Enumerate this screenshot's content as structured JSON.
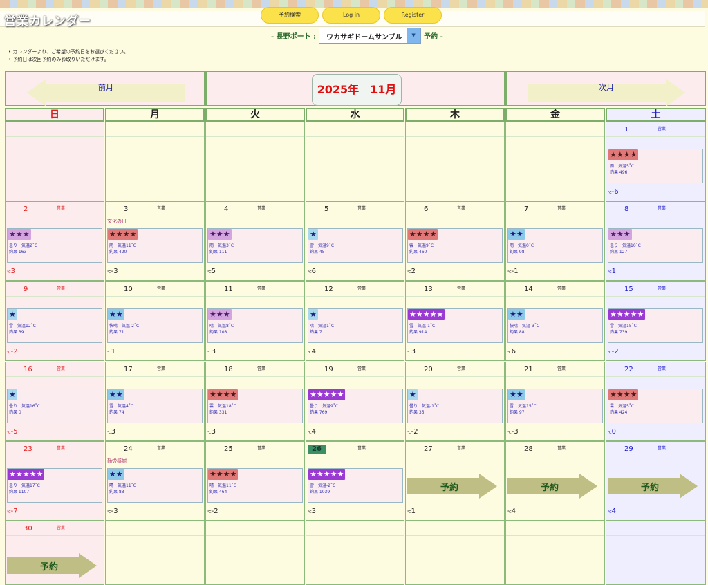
{
  "header": {
    "app_title": "営業カレンダー",
    "buttons": [
      "予約検索",
      "Log in",
      "Register"
    ]
  },
  "port": {
    "prefix": "- 長野ポート :",
    "selected": "ワカサギドームサンプル",
    "suffix": "予約 -"
  },
  "notes": [
    "カレンダーより、ご希望の予約日をお選びください。",
    "予約日は次回予約のみお取りいただけます。"
  ],
  "calendar": {
    "prev": "前月",
    "next": "次月",
    "month_label": "2025年　11月",
    "weekdays": [
      "日",
      "月",
      "火",
      "水",
      "木",
      "金",
      "土"
    ],
    "open_label": "営業",
    "reserve_label": "予約",
    "days": [
      {
        "d": "1",
        "col": 6,
        "row": 0,
        "stars": "★★★★",
        "level": 4,
        "weather": "雨　気温5˚C",
        "catch": "釣果 496",
        "water": "-6",
        "open": true
      },
      {
        "d": "2",
        "col": 0,
        "row": 1,
        "stars": "★★★",
        "level": 3,
        "weather": "曇り　気温2˚C",
        "catch": "釣果 163",
        "water": "3",
        "open": true
      },
      {
        "d": "3",
        "col": 1,
        "row": 1,
        "stars": "★★★★",
        "level": 4,
        "weather": "雨　気温11˚C",
        "catch": "釣果 420",
        "water": "-3",
        "open": true,
        "holiday": "文化の日"
      },
      {
        "d": "4",
        "col": 2,
        "row": 1,
        "stars": "★★★",
        "level": 3,
        "weather": "雨　気温3˚C",
        "catch": "釣果 111",
        "water": "5",
        "open": true
      },
      {
        "d": "5",
        "col": 3,
        "row": 1,
        "stars": "★",
        "level": 1,
        "weather": "雪　気温9˚C",
        "catch": "釣果 45",
        "water": "6",
        "open": true
      },
      {
        "d": "6",
        "col": 4,
        "row": 1,
        "stars": "★★★★",
        "level": 4,
        "weather": "雲　気温9˚C",
        "catch": "釣果 460",
        "water": "2",
        "open": true
      },
      {
        "d": "7",
        "col": 5,
        "row": 1,
        "stars": "★★",
        "level": 2,
        "weather": "雨　気温0˚C",
        "catch": "釣果 98",
        "water": "-1",
        "open": true
      },
      {
        "d": "8",
        "col": 6,
        "row": 1,
        "stars": "★★★",
        "level": 3,
        "weather": "曇り　気温10˚C",
        "catch": "釣果 127",
        "water": "1",
        "open": true
      },
      {
        "d": "9",
        "col": 0,
        "row": 2,
        "stars": "★",
        "level": 1,
        "weather": "雪　気温12˚C",
        "catch": "釣果 39",
        "water": "-2",
        "open": true
      },
      {
        "d": "10",
        "col": 1,
        "row": 2,
        "stars": "★★",
        "level": 2,
        "weather": "快晴　気温-2˚C",
        "catch": "釣果 71",
        "water": "1",
        "open": true
      },
      {
        "d": "11",
        "col": 2,
        "row": 2,
        "stars": "★★★",
        "level": 3,
        "weather": "晴　気温8˚C",
        "catch": "釣果 108",
        "water": "3",
        "open": true
      },
      {
        "d": "12",
        "col": 3,
        "row": 2,
        "stars": "★",
        "level": 1,
        "weather": "晴　気温1˚C",
        "catch": "釣果 7",
        "water": "4",
        "open": true
      },
      {
        "d": "13",
        "col": 4,
        "row": 2,
        "stars": "★★★★★",
        "level": 5,
        "weather": "雪　気温-1˚C",
        "catch": "釣果 914",
        "water": "3",
        "open": true
      },
      {
        "d": "14",
        "col": 5,
        "row": 2,
        "stars": "★★",
        "level": 2,
        "weather": "快晴　気温-3˚C",
        "catch": "釣果 88",
        "water": "6",
        "open": true
      },
      {
        "d": "15",
        "col": 6,
        "row": 2,
        "stars": "★★★★★",
        "level": 5,
        "weather": "雪　気温15˚C",
        "catch": "釣果 739",
        "water": "-2",
        "open": true
      },
      {
        "d": "16",
        "col": 0,
        "row": 3,
        "stars": "★",
        "level": 1,
        "weather": "曇り　気温16˚C",
        "catch": "釣果 0",
        "water": "-5",
        "open": true
      },
      {
        "d": "17",
        "col": 1,
        "row": 3,
        "stars": "★★",
        "level": 2,
        "weather": "雪　気温4˚C",
        "catch": "釣果 74",
        "water": "3",
        "open": true
      },
      {
        "d": "18",
        "col": 2,
        "row": 3,
        "stars": "★★★★",
        "level": 4,
        "weather": "雲　気温18˚C",
        "catch": "釣果 331",
        "water": "3",
        "open": true
      },
      {
        "d": "19",
        "col": 3,
        "row": 3,
        "stars": "★★★★★",
        "level": 5,
        "weather": "曇り　気温9˚C",
        "catch": "釣果 769",
        "water": "4",
        "open": true
      },
      {
        "d": "20",
        "col": 4,
        "row": 3,
        "stars": "★",
        "level": 1,
        "weather": "曇り　気温-1˚C",
        "catch": "釣果 35",
        "water": "-2",
        "open": true
      },
      {
        "d": "21",
        "col": 5,
        "row": 3,
        "stars": "★★",
        "level": 2,
        "weather": "雪　気温15˚C",
        "catch": "釣果 97",
        "water": "-3",
        "open": true
      },
      {
        "d": "22",
        "col": 6,
        "row": 3,
        "stars": "★★★★",
        "level": 4,
        "weather": "雲　気温5˚C",
        "catch": "釣果 424",
        "water": "0",
        "open": true
      },
      {
        "d": "23",
        "col": 0,
        "row": 4,
        "stars": "★★★★★",
        "level": 5,
        "weather": "曇り　気温17˚C",
        "catch": "釣果 1107",
        "water": "-7",
        "open": true
      },
      {
        "d": "24",
        "col": 1,
        "row": 4,
        "stars": "★★",
        "level": 2,
        "weather": "晴　気温11˚C",
        "catch": "釣果 83",
        "water": "-3",
        "open": true,
        "holiday": "勤労感謝"
      },
      {
        "d": "25",
        "col": 2,
        "row": 4,
        "stars": "★★★★",
        "level": 4,
        "weather": "晴　気温11˚C",
        "catch": "釣果 464",
        "water": "-2",
        "open": true
      },
      {
        "d": "26",
        "col": 3,
        "row": 4,
        "stars": "★★★★★",
        "level": 5,
        "weather": "雪　気温-2˚C",
        "catch": "釣果 1039",
        "water": "3",
        "open": true,
        "today": true
      },
      {
        "d": "27",
        "col": 4,
        "row": 4,
        "reserve": true,
        "water": "1",
        "open": true
      },
      {
        "d": "28",
        "col": 5,
        "row": 4,
        "reserve": true,
        "water": "4",
        "open": true
      },
      {
        "d": "29",
        "col": 6,
        "row": 4,
        "reserve": true,
        "water": "4",
        "open": true
      },
      {
        "d": "30",
        "col": 0,
        "row": 5,
        "reserve": true,
        "open": true
      }
    ],
    "blank_cells": [
      {
        "col": 0,
        "row": 0
      },
      {
        "col": 1,
        "row": 0
      },
      {
        "col": 2,
        "row": 0
      },
      {
        "col": 3,
        "row": 0
      },
      {
        "col": 4,
        "row": 0
      },
      {
        "col": 5,
        "row": 0
      },
      {
        "col": 1,
        "row": 5
      },
      {
        "col": 2,
        "row": 5
      },
      {
        "col": 3,
        "row": 5
      },
      {
        "col": 4,
        "row": 5
      },
      {
        "col": 5,
        "row": 5
      },
      {
        "col": 6,
        "row": 5
      }
    ]
  },
  "colors": {
    "level_colors": {
      "1": "#a8d8ee",
      "2": "#8cc8e8",
      "3": "#d4a4de",
      "4": "#e07878",
      "5": "#9a3ad2"
    },
    "level_star_colors": {
      "1": "#1a1a7a",
      "2": "#1a1a7a",
      "3": "#4a1a6a",
      "4": "#4a1a1a",
      "5": "#ffffff"
    }
  }
}
